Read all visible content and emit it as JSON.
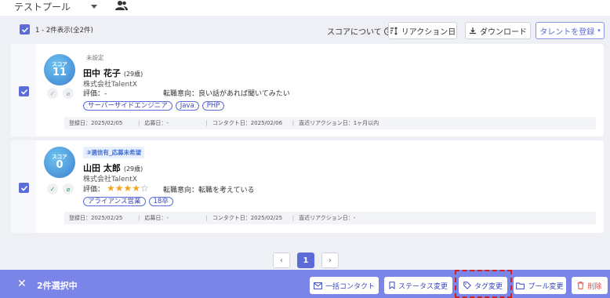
{
  "pool": {
    "name": "テストプール"
  },
  "list_header": {
    "count_text": "1 - 2件表示(全2件)",
    "score_about": "スコアについて",
    "reaction_button": "リアクション日",
    "download_button": "ダウンロード",
    "register_button": "タレントを登録"
  },
  "candidates": [
    {
      "score_label": "スコア",
      "score": "11",
      "status": "未設定",
      "name": "田中 花子",
      "age": "(29歳)",
      "company": "株式会社TalentX",
      "rating_label": "評価：-",
      "rating_stars": 0,
      "intent": "転職意向：良い話があれば聞いてみたい",
      "tags": [
        "サーバーサイドエンジニア",
        "Java",
        "PHP"
      ],
      "registered": "登録日：2025/02/05",
      "applied": "応募日：-",
      "contacted": "コンタクト日：2025/02/06",
      "reaction": "直近リアクション日：1ヶ月以内"
    },
    {
      "score_label": "スコア",
      "score": "0",
      "status": "③選信有_応募未希望",
      "name": "山田 太郎",
      "age": "(29歳)",
      "company": "株式会社TalentX",
      "rating_label": "評価：",
      "rating_stars": 4,
      "rating_stars_display": "★★★★",
      "rating_empty_display": "☆",
      "intent": "転職意向：転職を考えている",
      "tags": [
        "アライアンス営業",
        "18卒"
      ],
      "registered": "登録日：2025/02/25",
      "applied": "応募日：-",
      "contacted": "コンタクト日：2025/02/25",
      "reaction": "直近リアクション日：-"
    }
  ],
  "pagination": {
    "prev": "‹",
    "current": "1",
    "next": "›"
  },
  "bulk_bar": {
    "close": "✕",
    "selected": "2件選択中",
    "bulk_contact": "一括コンタクト",
    "status_change": "ステータス変更",
    "tag_change": "タグ変更",
    "pool_change": "プール変更",
    "delete": "削除"
  },
  "colors": {
    "accent": "#5b6bd7",
    "bulk_bar": "#7b85e8",
    "danger": "#e04b4b"
  }
}
